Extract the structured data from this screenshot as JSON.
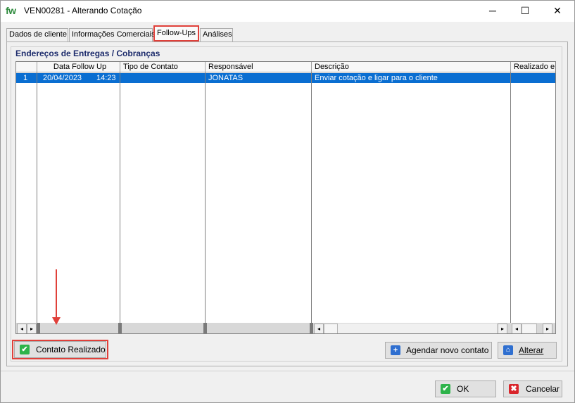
{
  "window": {
    "logo": "fw",
    "title": "VEN00281 - Alterando Cotação",
    "minimize": "─",
    "maximize": "☐",
    "close": "✕"
  },
  "tabs": [
    {
      "label": "Dados de cliente"
    },
    {
      "label": "Informações Comerciais"
    },
    {
      "label": "Follow-Ups",
      "selected": true
    },
    {
      "label": "Análises"
    }
  ],
  "group": {
    "title": "Endereços de Entregas / Cobranças"
  },
  "grid": {
    "columns": [
      "",
      "Data Follow Up",
      "Tipo de Contato",
      "Responsável",
      "Descrição",
      "Realizado e"
    ],
    "rows": [
      {
        "num": "1",
        "date": "20/04/2023",
        "time": "14:23",
        "tipo": "",
        "responsavel": "JONATAS",
        "descricao": "Enviar cotação e ligar para o cliente",
        "realizado": ""
      }
    ]
  },
  "buttons": {
    "contato_realizado": "Contato Realizado",
    "agendar": "Agendar novo contato",
    "alterar": "Alterar",
    "ok": "OK",
    "cancelar": "Cancelar"
  },
  "colors": {
    "selection": "#0a6ed1",
    "highlight": "#e0403a",
    "group_title": "#1b2a6b",
    "check_green": "#2db34a",
    "cancel_red": "#d9252b",
    "plus_blue": "#2f6fd0"
  },
  "icons": {
    "check": "✔",
    "cross": "✖",
    "plus": "+",
    "edit": "⌂"
  }
}
